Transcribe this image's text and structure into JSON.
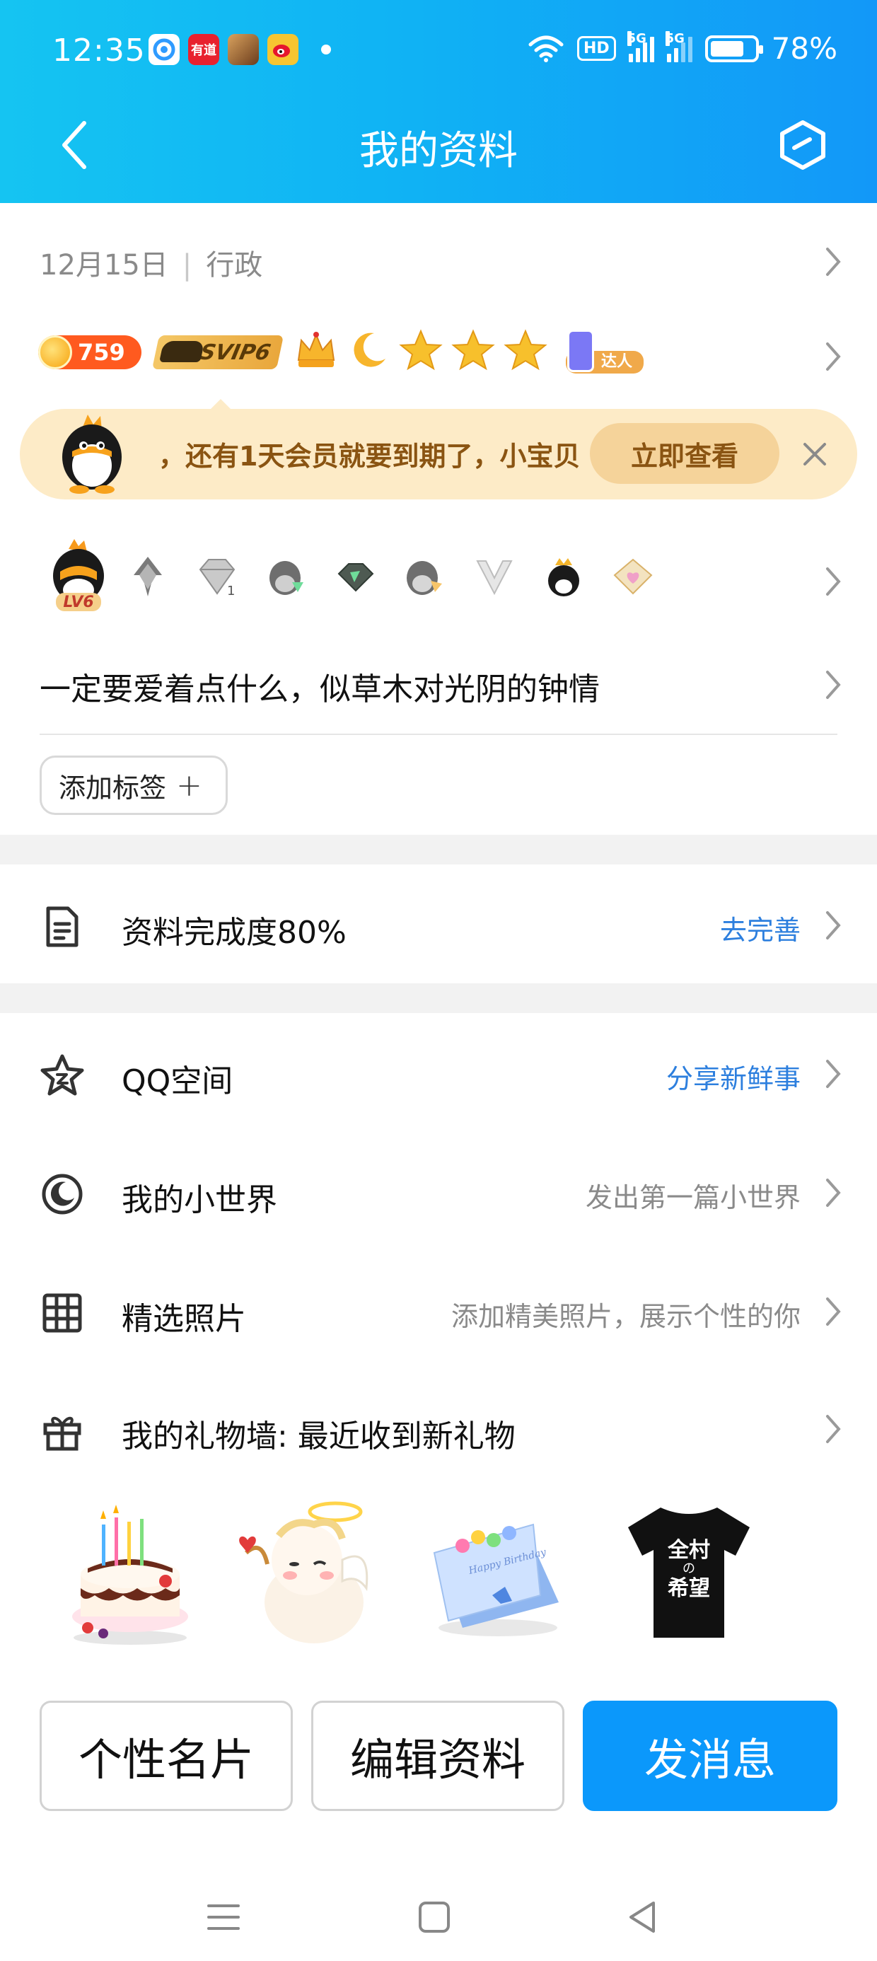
{
  "status_bar": {
    "time": "12:35",
    "app_icons": [
      {
        "name": "app-q",
        "color": "#3aa7ff",
        "label": ""
      },
      {
        "name": "youdao",
        "color": "#e8212e",
        "label": "有道"
      },
      {
        "name": "game-avatar",
        "color": "#8a5a2a",
        "label": ""
      },
      {
        "name": "weibo",
        "color": "#f7c531",
        "label": ""
      }
    ],
    "hd_label": "HD",
    "signal_label": "5G",
    "battery_percent": "78%",
    "battery_level": 0.78
  },
  "header": {
    "title": "我的资料",
    "accent": "#12a9f5"
  },
  "profile": {
    "date": "12月15日",
    "job": "行政",
    "coins": "759",
    "svip_label": "SVIP6",
    "daren_label": "达人",
    "level_badge": "LV6",
    "signature": "一定要爱着点什么，似草木对光阴的钟情"
  },
  "vip_banner": {
    "message": "，还有1天会员就要到期了，小宝贝",
    "button": "立即查看"
  },
  "tag_button": {
    "label": "添加标签"
  },
  "completion": {
    "label": "资料完成度80%",
    "action": "去完善"
  },
  "menu": [
    {
      "icon": "star-icon",
      "label": "QQ空间",
      "right": "分享新鲜事",
      "right_color": "blue"
    },
    {
      "icon": "circle-moon-icon",
      "label": "我的小世界",
      "right": "发出第一篇小世界",
      "right_color": "gray"
    },
    {
      "icon": "grid-icon",
      "label": "精选照片",
      "right": "添加精美照片，展示个性的你",
      "right_color": "gray"
    },
    {
      "icon": "gift-icon",
      "label": "我的礼物墙: 最近收到新礼物",
      "right": "",
      "right_color": "gray"
    }
  ],
  "gifts": {
    "tshirt_text_1": "全村",
    "tshirt_text_2": "の",
    "tshirt_text_3": "希望",
    "card_text": "Happy Birthday"
  },
  "buttons": {
    "card": "个性名片",
    "edit": "编辑资料",
    "message": "发消息"
  }
}
